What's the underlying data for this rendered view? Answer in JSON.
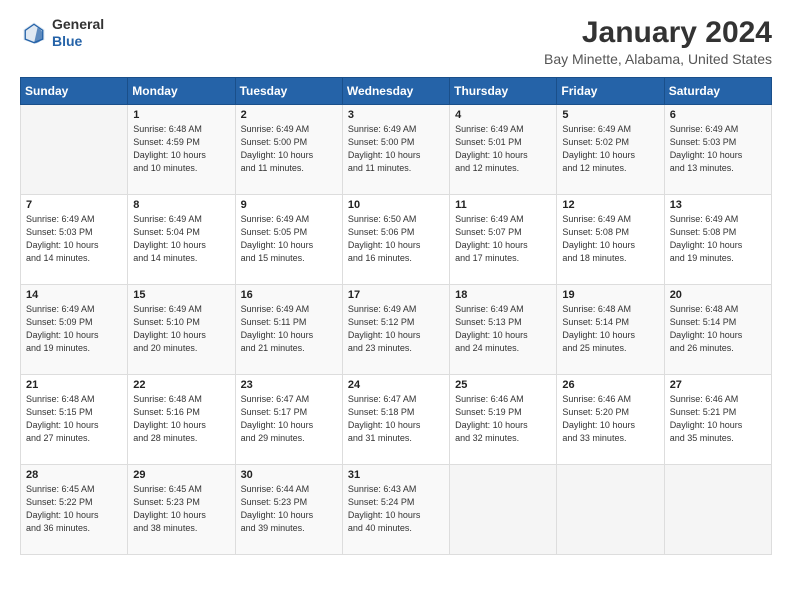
{
  "header": {
    "logo_line1": "General",
    "logo_line2": "Blue",
    "title": "January 2024",
    "subtitle": "Bay Minette, Alabama, United States"
  },
  "calendar": {
    "days_of_week": [
      "Sunday",
      "Monday",
      "Tuesday",
      "Wednesday",
      "Thursday",
      "Friday",
      "Saturday"
    ],
    "weeks": [
      [
        {
          "day": "",
          "info": ""
        },
        {
          "day": "1",
          "info": "Sunrise: 6:48 AM\nSunset: 4:59 PM\nDaylight: 10 hours\nand 10 minutes."
        },
        {
          "day": "2",
          "info": "Sunrise: 6:49 AM\nSunset: 5:00 PM\nDaylight: 10 hours\nand 11 minutes."
        },
        {
          "day": "3",
          "info": "Sunrise: 6:49 AM\nSunset: 5:00 PM\nDaylight: 10 hours\nand 11 minutes."
        },
        {
          "day": "4",
          "info": "Sunrise: 6:49 AM\nSunset: 5:01 PM\nDaylight: 10 hours\nand 12 minutes."
        },
        {
          "day": "5",
          "info": "Sunrise: 6:49 AM\nSunset: 5:02 PM\nDaylight: 10 hours\nand 12 minutes."
        },
        {
          "day": "6",
          "info": "Sunrise: 6:49 AM\nSunset: 5:03 PM\nDaylight: 10 hours\nand 13 minutes."
        }
      ],
      [
        {
          "day": "7",
          "info": "Sunrise: 6:49 AM\nSunset: 5:03 PM\nDaylight: 10 hours\nand 14 minutes."
        },
        {
          "day": "8",
          "info": "Sunrise: 6:49 AM\nSunset: 5:04 PM\nDaylight: 10 hours\nand 14 minutes."
        },
        {
          "day": "9",
          "info": "Sunrise: 6:49 AM\nSunset: 5:05 PM\nDaylight: 10 hours\nand 15 minutes."
        },
        {
          "day": "10",
          "info": "Sunrise: 6:50 AM\nSunset: 5:06 PM\nDaylight: 10 hours\nand 16 minutes."
        },
        {
          "day": "11",
          "info": "Sunrise: 6:49 AM\nSunset: 5:07 PM\nDaylight: 10 hours\nand 17 minutes."
        },
        {
          "day": "12",
          "info": "Sunrise: 6:49 AM\nSunset: 5:08 PM\nDaylight: 10 hours\nand 18 minutes."
        },
        {
          "day": "13",
          "info": "Sunrise: 6:49 AM\nSunset: 5:08 PM\nDaylight: 10 hours\nand 19 minutes."
        }
      ],
      [
        {
          "day": "14",
          "info": "Sunrise: 6:49 AM\nSunset: 5:09 PM\nDaylight: 10 hours\nand 19 minutes."
        },
        {
          "day": "15",
          "info": "Sunrise: 6:49 AM\nSunset: 5:10 PM\nDaylight: 10 hours\nand 20 minutes."
        },
        {
          "day": "16",
          "info": "Sunrise: 6:49 AM\nSunset: 5:11 PM\nDaylight: 10 hours\nand 21 minutes."
        },
        {
          "day": "17",
          "info": "Sunrise: 6:49 AM\nSunset: 5:12 PM\nDaylight: 10 hours\nand 23 minutes."
        },
        {
          "day": "18",
          "info": "Sunrise: 6:49 AM\nSunset: 5:13 PM\nDaylight: 10 hours\nand 24 minutes."
        },
        {
          "day": "19",
          "info": "Sunrise: 6:48 AM\nSunset: 5:14 PM\nDaylight: 10 hours\nand 25 minutes."
        },
        {
          "day": "20",
          "info": "Sunrise: 6:48 AM\nSunset: 5:14 PM\nDaylight: 10 hours\nand 26 minutes."
        }
      ],
      [
        {
          "day": "21",
          "info": "Sunrise: 6:48 AM\nSunset: 5:15 PM\nDaylight: 10 hours\nand 27 minutes."
        },
        {
          "day": "22",
          "info": "Sunrise: 6:48 AM\nSunset: 5:16 PM\nDaylight: 10 hours\nand 28 minutes."
        },
        {
          "day": "23",
          "info": "Sunrise: 6:47 AM\nSunset: 5:17 PM\nDaylight: 10 hours\nand 29 minutes."
        },
        {
          "day": "24",
          "info": "Sunrise: 6:47 AM\nSunset: 5:18 PM\nDaylight: 10 hours\nand 31 minutes."
        },
        {
          "day": "25",
          "info": "Sunrise: 6:46 AM\nSunset: 5:19 PM\nDaylight: 10 hours\nand 32 minutes."
        },
        {
          "day": "26",
          "info": "Sunrise: 6:46 AM\nSunset: 5:20 PM\nDaylight: 10 hours\nand 33 minutes."
        },
        {
          "day": "27",
          "info": "Sunrise: 6:46 AM\nSunset: 5:21 PM\nDaylight: 10 hours\nand 35 minutes."
        }
      ],
      [
        {
          "day": "28",
          "info": "Sunrise: 6:45 AM\nSunset: 5:22 PM\nDaylight: 10 hours\nand 36 minutes."
        },
        {
          "day": "29",
          "info": "Sunrise: 6:45 AM\nSunset: 5:23 PM\nDaylight: 10 hours\nand 38 minutes."
        },
        {
          "day": "30",
          "info": "Sunrise: 6:44 AM\nSunset: 5:23 PM\nDaylight: 10 hours\nand 39 minutes."
        },
        {
          "day": "31",
          "info": "Sunrise: 6:43 AM\nSunset: 5:24 PM\nDaylight: 10 hours\nand 40 minutes."
        },
        {
          "day": "",
          "info": ""
        },
        {
          "day": "",
          "info": ""
        },
        {
          "day": "",
          "info": ""
        }
      ]
    ]
  }
}
